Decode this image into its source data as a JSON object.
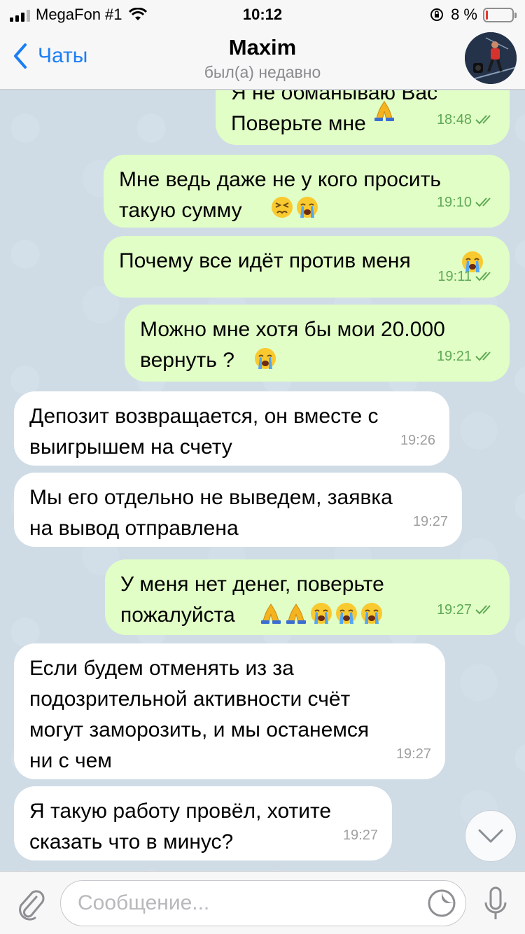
{
  "status_bar": {
    "carrier": "MegaFon #1",
    "time": "10:12",
    "battery_text": "8 %",
    "battery_level": 0.08,
    "battery_color": "#e23a2d"
  },
  "header": {
    "back_label": "Чаты",
    "title": "Maxim",
    "subtitle": "был(а) недавно"
  },
  "colors": {
    "outgoing_bubble": "#e1fec6",
    "incoming_bubble": "#ffffff",
    "accent": "#1b7ef5",
    "outgoing_time": "#5fa955"
  },
  "messages": [
    {
      "direction": "out",
      "text": "Я не обманываю Вас\nПоверьте мне",
      "emojis": [
        "pray"
      ],
      "time": "18:48",
      "read": true
    },
    {
      "direction": "out",
      "text": "Мне ведь даже не у кого просить\nтакую сумму",
      "emojis": [
        "persevere",
        "sob"
      ],
      "time": "19:10",
      "read": true
    },
    {
      "direction": "out",
      "text": "Почему все идёт против меня",
      "emojis": [
        "sob"
      ],
      "time": "19:11",
      "read": true
    },
    {
      "direction": "out",
      "text": "Можно мне хотя бы мои 20.000\nвернуть ?",
      "emojis": [
        "sob"
      ],
      "time": "19:21",
      "read": true
    },
    {
      "direction": "in",
      "text": "Депозит возвращается, он вместе с\nвыигрышем на счету",
      "emojis": [],
      "time": "19:26"
    },
    {
      "direction": "in",
      "text": "Мы его отдельно не выведем, заявка\nна вывод отправлена",
      "emojis": [],
      "time": "19:27"
    },
    {
      "direction": "out",
      "text": "У меня нет денег, поверьте\nпожалуйста",
      "emojis": [
        "pray",
        "pray",
        "sob",
        "sob",
        "sob"
      ],
      "time": "19:27",
      "read": true
    },
    {
      "direction": "in",
      "text": "Если будем отменять из за\nподозрительной активности счёт\nмогут заморозить, и мы останемся\nни с чем",
      "emojis": [],
      "time": "19:27"
    },
    {
      "direction": "in",
      "text": "Я такую работу провёл, хотите\nсказать что в минус?",
      "emojis": [],
      "time": "19:27"
    }
  ],
  "composer": {
    "placeholder": "Сообщение..."
  },
  "icons": {
    "back": "chevron-left-icon",
    "scroll": "chevron-down-icon",
    "attach": "paperclip-icon",
    "sticker": "sticker-icon",
    "mic": "microphone-icon"
  }
}
